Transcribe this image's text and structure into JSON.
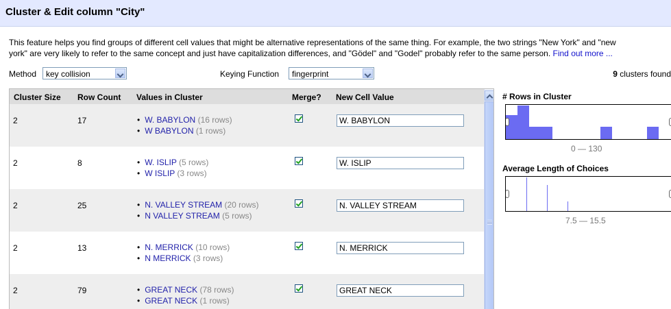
{
  "dialog": {
    "title": "Cluster & Edit column \"City\"",
    "description_line1": "This feature helps you find groups of different cell values that might be alternative representations of the same thing. For example, the two strings \"New York\" and \"new",
    "description_line2": "york\" are very likely to refer to the same concept and just have capitalization differences, and \"Gödel\" and \"Godel\" probably refer to the same person.",
    "find_out_more": "Find out more ..."
  },
  "controls": {
    "method_label": "Method",
    "method_value": "key collision",
    "keying_label": "Keying Function",
    "keying_value": "fingerprint",
    "clusters_count": "9",
    "clusters_suffix": " clusters found"
  },
  "table": {
    "headers": {
      "cluster_size": "Cluster Size",
      "row_count": "Row Count",
      "values": "Values in Cluster",
      "merge": "Merge?",
      "new_value": "New Cell Value"
    },
    "rows": [
      {
        "size": "2",
        "count": "17",
        "values": [
          {
            "name": "W. BABYLON",
            "rows": "(16 rows)"
          },
          {
            "name": "W BABYLON",
            "rows": "(1 rows)"
          }
        ],
        "merge": true,
        "new_value": "W. BABYLON"
      },
      {
        "size": "2",
        "count": "8",
        "values": [
          {
            "name": "W. ISLIP",
            "rows": "(5 rows)"
          },
          {
            "name": "W ISLIP",
            "rows": "(3 rows)"
          }
        ],
        "merge": true,
        "new_value": "W. ISLIP"
      },
      {
        "size": "2",
        "count": "25",
        "values": [
          {
            "name": "N. VALLEY STREAM",
            "rows": "(20 rows)"
          },
          {
            "name": "N VALLEY STREAM",
            "rows": "(5 rows)"
          }
        ],
        "merge": true,
        "new_value": "N. VALLEY STREAM"
      },
      {
        "size": "2",
        "count": "13",
        "values": [
          {
            "name": "N. MERRICK",
            "rows": "(10 rows)"
          },
          {
            "name": "N MERRICK",
            "rows": "(3 rows)"
          }
        ],
        "merge": true,
        "new_value": "N. MERRICK"
      },
      {
        "size": "2",
        "count": "79",
        "values": [
          {
            "name": "GREAT NECK",
            "rows": "(78 rows)"
          },
          {
            "name": "GREAT NECK",
            "rows": "(1 rows)"
          }
        ],
        "merge": true,
        "new_value": "GREAT NECK"
      }
    ]
  },
  "facets": {
    "rows_title": "# Rows in Cluster",
    "rows_range": "0 — 130",
    "length_title": "Average Length of Choices",
    "length_range": "7.5 — 15.5",
    "bar_color": "#6b6bf2",
    "rows_histogram": [
      0.71,
      1.0,
      0.36,
      0.36,
      0.0,
      0.36,
      0.0,
      0.36
    ],
    "length_lines": [
      1.0,
      0.77,
      0.29
    ]
  }
}
